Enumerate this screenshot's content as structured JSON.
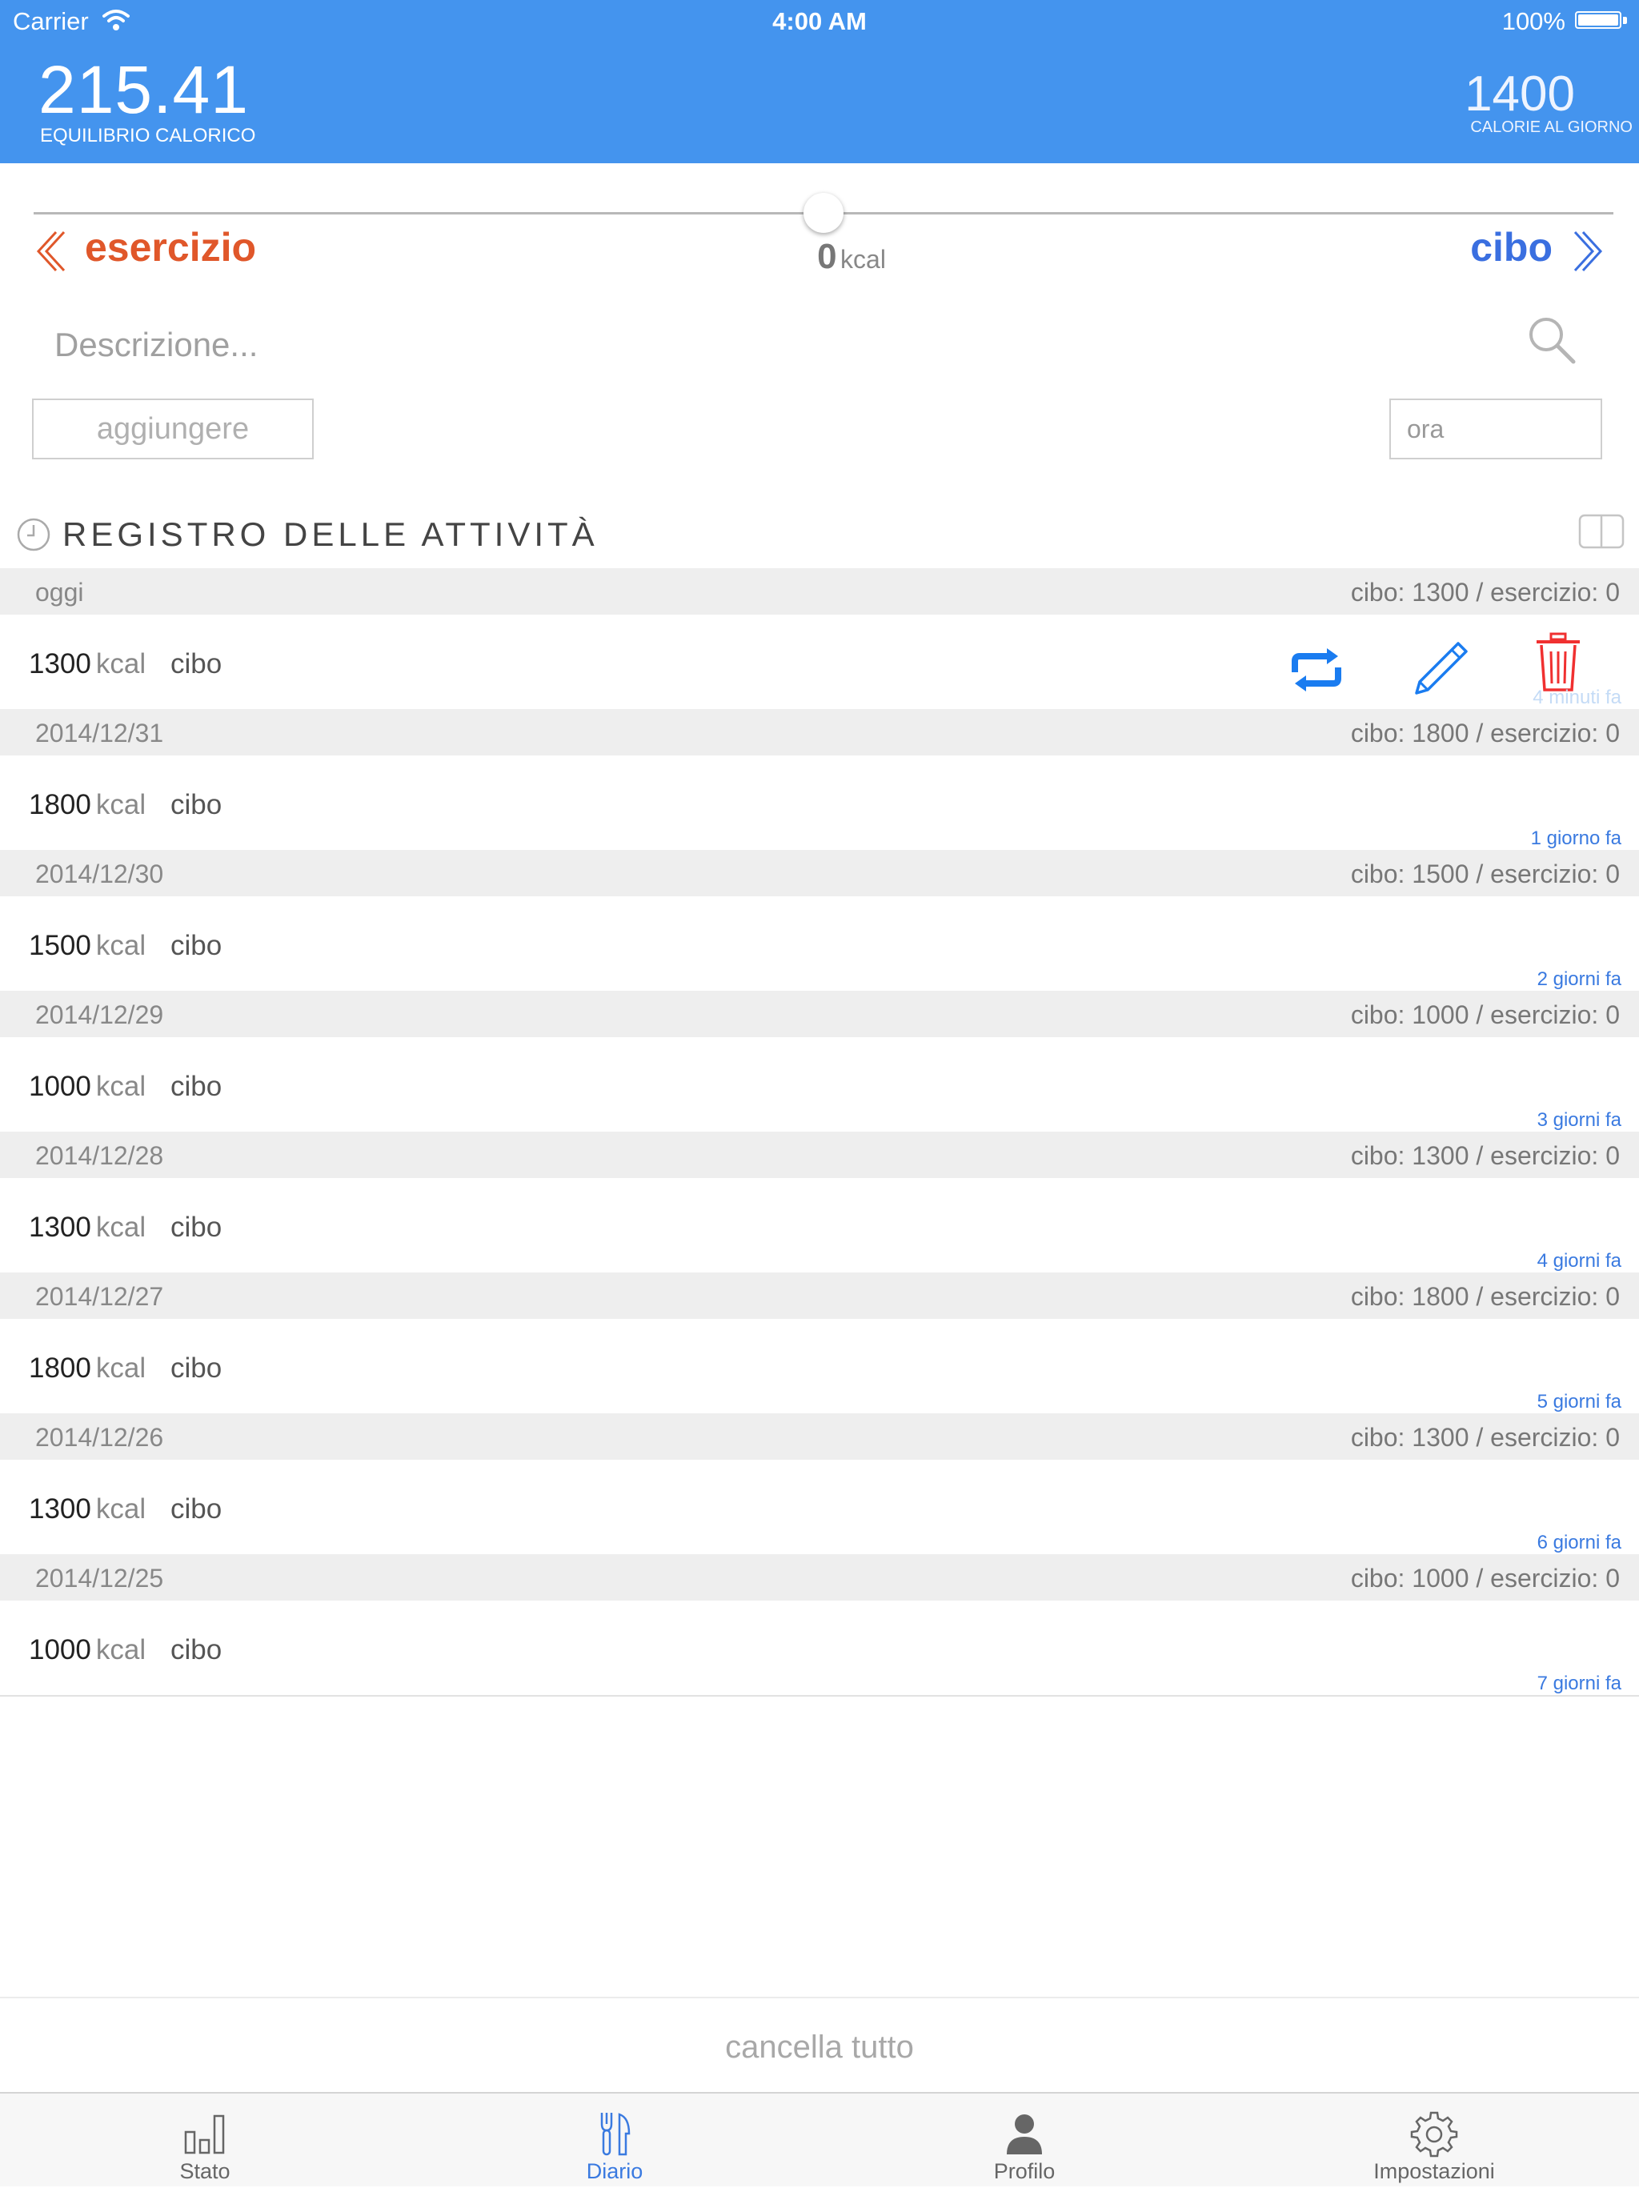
{
  "status_bar": {
    "carrier": "Carrier",
    "time": "4:00 AM",
    "battery": "100%"
  },
  "header": {
    "balance_value": "215.41",
    "balance_label": "EQUILIBRIO CALORICO",
    "daily_value": "1400",
    "daily_label": "CALORIE AL GIORNO"
  },
  "slider": {
    "level": 0.5
  },
  "mode": {
    "exercise_label": "esercizio",
    "food_label": "cibo",
    "kcal_value": "0",
    "kcal_unit": "kcal"
  },
  "form": {
    "description_placeholder": "Descrizione...",
    "add_label": "aggiungere",
    "time_placeholder": "ora"
  },
  "log": {
    "title": "REGISTRO DELLE ATTIVITÀ",
    "days": [
      {
        "date": "oggi",
        "summary": "cibo: 1300 / esercizio: 0",
        "entry": {
          "kcal": "1300",
          "unit": "kcal",
          "type": "cibo",
          "ago": "4 minuti fa"
        }
      },
      {
        "date": "2014/12/31",
        "summary": "cibo: 1800 / esercizio: 0",
        "entry": {
          "kcal": "1800",
          "unit": "kcal",
          "type": "cibo",
          "ago": "1 giorno fa"
        }
      },
      {
        "date": "2014/12/30",
        "summary": "cibo: 1500 / esercizio: 0",
        "entry": {
          "kcal": "1500",
          "unit": "kcal",
          "type": "cibo",
          "ago": "2 giorni fa"
        }
      },
      {
        "date": "2014/12/29",
        "summary": "cibo: 1000 / esercizio: 0",
        "entry": {
          "kcal": "1000",
          "unit": "kcal",
          "type": "cibo",
          "ago": "3 giorni fa"
        }
      },
      {
        "date": "2014/12/28",
        "summary": "cibo: 1300 / esercizio: 0",
        "entry": {
          "kcal": "1300",
          "unit": "kcal",
          "type": "cibo",
          "ago": "4 giorni fa"
        }
      },
      {
        "date": "2014/12/27",
        "summary": "cibo: 1800 / esercizio: 0",
        "entry": {
          "kcal": "1800",
          "unit": "kcal",
          "type": "cibo",
          "ago": "5 giorni fa"
        }
      },
      {
        "date": "2014/12/26",
        "summary": "cibo: 1300 / esercizio: 0",
        "entry": {
          "kcal": "1300",
          "unit": "kcal",
          "type": "cibo",
          "ago": "6 giorni fa"
        }
      },
      {
        "date": "2014/12/25",
        "summary": "cibo: 1000 / esercizio: 0",
        "entry": {
          "kcal": "1000",
          "unit": "kcal",
          "type": "cibo",
          "ago": "7 giorni fa"
        }
      }
    ]
  },
  "clear_all": "cancella tutto",
  "tabs": [
    {
      "label": "Stato",
      "icon": "bar-chart-icon"
    },
    {
      "label": "Diario",
      "icon": "fork-knife-icon",
      "active": true
    },
    {
      "label": "Profilo",
      "icon": "person-icon"
    },
    {
      "label": "Impostazioni",
      "icon": "gear-icon"
    }
  ],
  "colors": {
    "header_blue": "#4494ee",
    "exercise_orange": "#e0572a",
    "food_blue": "#3a6fe0",
    "repeat_blue": "#1a7cf0",
    "delete_red": "#f03030",
    "tab_active": "#3a7ae0"
  }
}
